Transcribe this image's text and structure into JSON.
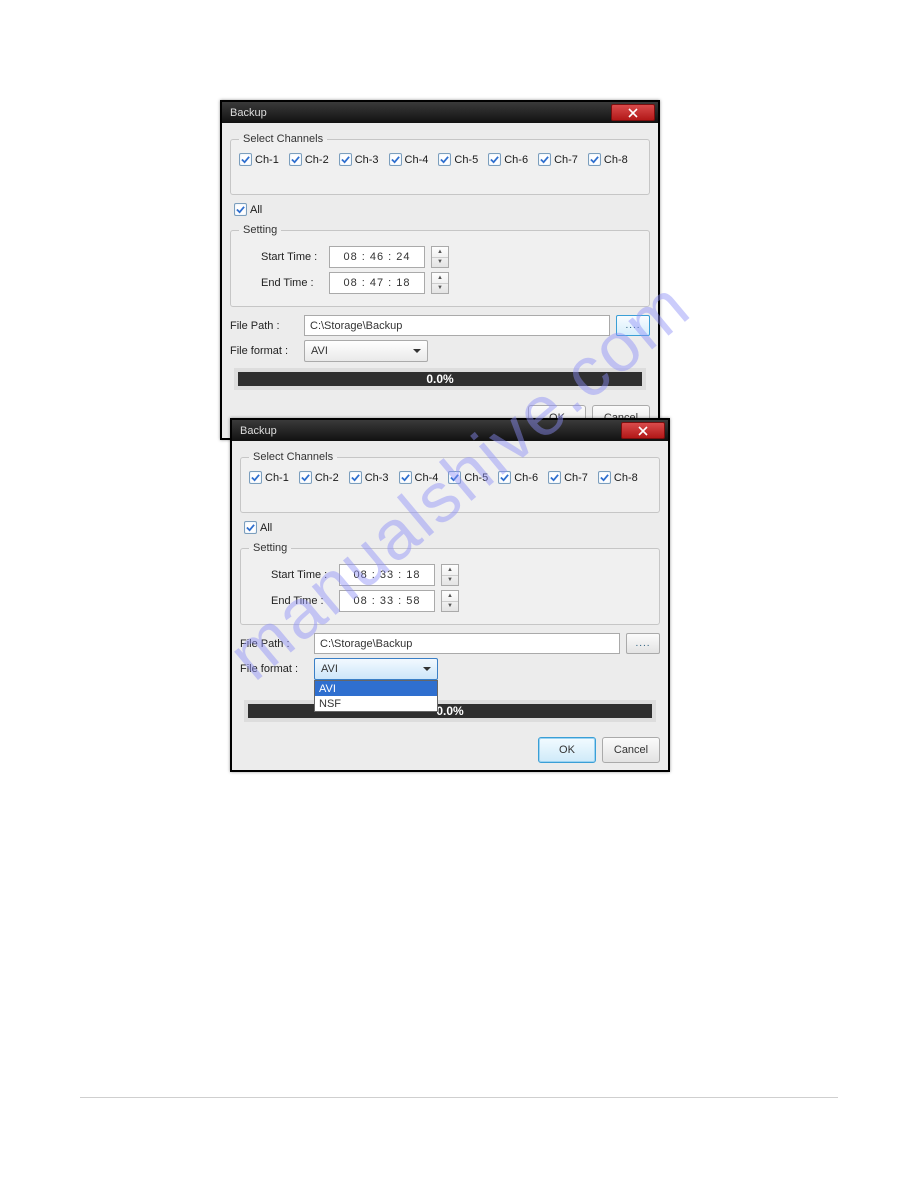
{
  "watermark": "manualshive.com",
  "dlg1": {
    "title": "Backup",
    "select_channels_legend": "Select Channels",
    "channels": [
      "Ch-1",
      "Ch-2",
      "Ch-3",
      "Ch-4",
      "Ch-5",
      "Ch-6",
      "Ch-7",
      "Ch-8"
    ],
    "all_label": "All",
    "setting_legend": "Setting",
    "start_time_label": "Start Time :",
    "end_time_label": "End Time  :",
    "start_time": "08 : 46 : 24",
    "end_time": "08 : 47 : 18",
    "file_path_label": "File Path :",
    "file_path_value": "C:\\Storage\\Backup",
    "browse_label": "....",
    "file_format_label": "File format :",
    "file_format_value": "AVI",
    "progress": "0.0%",
    "ok": "OK",
    "cancel": "Cancel"
  },
  "dlg2": {
    "title": "Backup",
    "select_channels_legend": "Select Channels",
    "channels": [
      "Ch-1",
      "Ch-2",
      "Ch-3",
      "Ch-4",
      "Ch-5",
      "Ch-6",
      "Ch-7",
      "Ch-8"
    ],
    "all_label": "All",
    "setting_legend": "Setting",
    "start_time_label": "Start Time :",
    "end_time_label": "End Time  :",
    "start_time": "08 : 33 : 18",
    "end_time": "08 : 33 : 58",
    "file_path_label": "File Path :",
    "file_path_value": "C:\\Storage\\Backup",
    "browse_label": "....",
    "file_format_label": "File format :",
    "file_format_value": "AVI",
    "format_options": [
      "AVI",
      "NSF"
    ],
    "progress": "0.0%",
    "ok": "OK",
    "cancel": "Cancel"
  }
}
